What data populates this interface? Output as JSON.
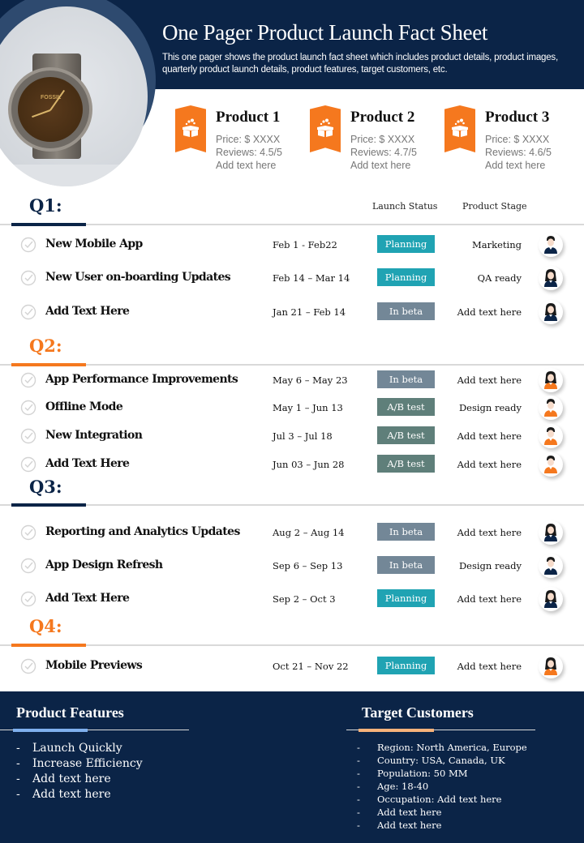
{
  "header": {
    "title": "One Pager Product Launch Fact Sheet",
    "subtitle": "This one pager shows the product launch fact sheet which includes product details, product images, quarterly product launch details, product features, target customers, etc.",
    "image": "watch-photo"
  },
  "products": [
    {
      "name": "Product 1",
      "price": "Price: $ XXXX",
      "reviews": "Reviews:  4.5/5",
      "note": "Add text here",
      "icon": "gift-box-icon"
    },
    {
      "name": "Product 2",
      "price": "Price: $ XXXX",
      "reviews": "Reviews:  4.7/5",
      "note": "Add text here",
      "icon": "gift-box-icon"
    },
    {
      "name": "Product 3",
      "price": "Price: $ XXXX",
      "reviews": "Reviews:  4.6/5",
      "note": "Add text here",
      "icon": "gift-box-icon"
    }
  ],
  "columns": {
    "launch_status": "Launch Status",
    "product_stage": "Product Stage"
  },
  "colors": {
    "navy": "#0b2447",
    "orange": "#f5781e",
    "planning": "#20a3b3",
    "in_beta": "#738797",
    "ab_test": "#5f7f7a",
    "features_accent": "#7fb0ee",
    "customers_accent": "#f7b27a"
  },
  "quarters": [
    {
      "label": "Q1:",
      "color": "navy",
      "rows": [
        {
          "task": "New Mobile App",
          "dates": "Feb 1 - Feb22",
          "status": "Planning",
          "status_type": "planning",
          "stage": "Marketing",
          "avatar": "man-navy"
        },
        {
          "task": "New User on-boarding Updates",
          "dates": "Feb 14 – Mar 14",
          "status": "Planning",
          "status_type": "planning",
          "stage": "QA ready",
          "avatar": "woman-navy"
        },
        {
          "task": "Add Text Here",
          "dates": "Jan 21 – Feb 14",
          "status": "In beta",
          "status_type": "in_beta",
          "stage": "Add  text here",
          "avatar": "woman-navy"
        }
      ]
    },
    {
      "label": "Q2:",
      "color": "orange",
      "rows": [
        {
          "task": "App Performance Improvements",
          "dates": "May 6 – May 23",
          "status": "In beta",
          "status_type": "in_beta",
          "stage": "Add  text here",
          "avatar": "woman-orange"
        },
        {
          "task": "Offline Mode",
          "dates": "May 1 – Jun 13",
          "status": "A/B test",
          "status_type": "ab_test",
          "stage": "Design ready",
          "avatar": "man-orange"
        },
        {
          "task": "New Integration",
          "dates": "Jul 3 – Jul 18",
          "status": "A/B test",
          "status_type": "ab_test",
          "stage": "Add  text here",
          "avatar": "man-orange"
        },
        {
          "task": "Add Text Here",
          "dates": "Jun 03 – Jun 28",
          "status": "A/B test",
          "status_type": "ab_test",
          "stage": "Add  text here",
          "avatar": "man-orange"
        }
      ]
    },
    {
      "label": "Q3:",
      "color": "navy",
      "rows": [
        {
          "task": "Reporting and Analytics Updates",
          "dates": "Aug 2 – Aug 14",
          "status": "In beta",
          "status_type": "in_beta",
          "stage": "Add  text here",
          "avatar": "woman-navy"
        },
        {
          "task": "App Design Refresh",
          "dates": "Sep 6 – Sep  13",
          "status": "In beta",
          "status_type": "in_beta",
          "stage": "Design ready",
          "avatar": "man-navy"
        },
        {
          "task": "Add Text Here",
          "dates": "Sep 2 – Oct 3",
          "status": "Planning",
          "status_type": "planning",
          "stage": "Add  text here",
          "avatar": "woman-navy"
        }
      ]
    },
    {
      "label": "Q4:",
      "color": "orange",
      "rows": [
        {
          "task": "Mobile Previews",
          "dates": "Oct 21 – Nov 22",
          "status": "Planning",
          "status_type": "planning",
          "stage": "Add  text here",
          "avatar": "woman-orange"
        }
      ]
    }
  ],
  "features": {
    "title": "Product Features",
    "items": [
      "Launch Quickly",
      "Increase Efficiency",
      "Add text here",
      "Add text here"
    ]
  },
  "customers": {
    "title": "Target Customers",
    "items": [
      "Region:  North America,  Europe",
      "Country:  USA,  Canada,  UK",
      "Population:  50 MM",
      "Age:  18-40",
      "Occupation:  Add  text here",
      "Add  text here",
      "Add  text here"
    ]
  }
}
